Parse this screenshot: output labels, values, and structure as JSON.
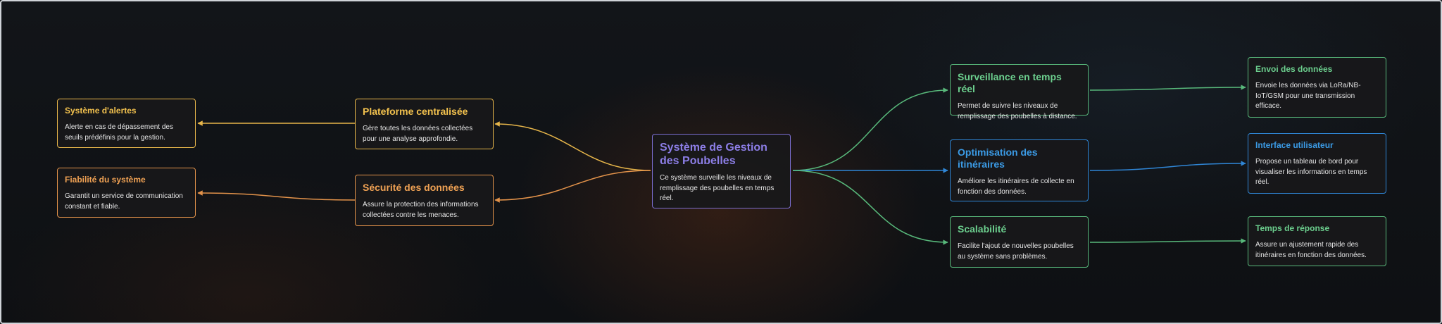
{
  "center": {
    "title": "Système de Gestion des Poubelles",
    "text": "Ce système surveille les niveaux de remplissage des poubelles en temps réel.",
    "color": "#7c6fd3"
  },
  "left": [
    {
      "title": "Plateforme centralisée",
      "text": "Gère toutes les données collectées pour une analyse approfondie.",
      "color": "#e7b64a",
      "child": {
        "title": "Système d'alertes",
        "text": "Alerte en cas de dépassement des seuils prédéfinis pour la gestion."
      }
    },
    {
      "title": "Sécurité des données",
      "text": "Assure la protection des informations collectées contre les menaces.",
      "color": "#e2924a",
      "child": {
        "title": "Fiabilité du système",
        "text": "Garantit un service de communication constant et fiable."
      }
    }
  ],
  "right": [
    {
      "title": "Surveillance en temps réel",
      "text": "Permet de suivre les niveaux de remplissage des poubelles à distance.",
      "color": "#58b97b",
      "child": {
        "title": "Envoi des données",
        "text": "Envoie les données via LoRa/NB-IoT/GSM pour une transmission efficace."
      }
    },
    {
      "title": "Optimisation des itinéraires",
      "text": "Améliore les itinéraires de collecte en fonction des données.",
      "color": "#2f86d6",
      "child": {
        "title": "Interface utilisateur",
        "text": "Propose un tableau de bord pour visualiser les informations en temps réel."
      }
    },
    {
      "title": "Scalabilité",
      "text": "Facilite l'ajout de nouvelles poubelles au système sans problèmes.",
      "color": "#58b97b",
      "child": {
        "title": "Temps de réponse",
        "text": "Assure un ajustement rapide des itinéraires en fonction des données."
      }
    }
  ]
}
